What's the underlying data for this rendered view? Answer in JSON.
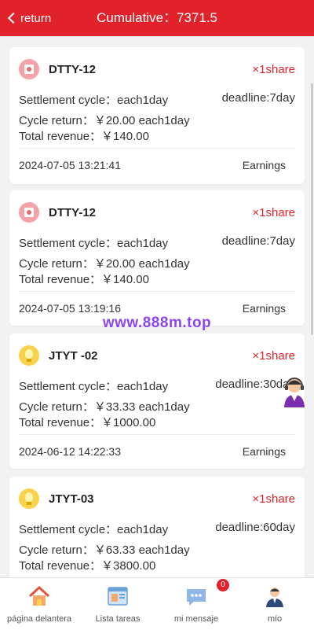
{
  "header": {
    "back_label": "return",
    "title": "Cumulative：7371.5"
  },
  "watermark": "www.888m.top",
  "cards": [
    {
      "icon": "gear-coin-icon",
      "name": "DTTY-12",
      "share": "×1share",
      "cycle": "Settlement cycle：each1day",
      "deadline": "deadline:7day",
      "cycle_return": "Cycle return：￥20.00 each1day",
      "total_revenue": "Total revenue：￥140.00",
      "datetime": "2024-07-05 13:21:41",
      "status": "Earnings"
    },
    {
      "icon": "gear-coin-icon",
      "name": "DTTY-12",
      "share": "×1share",
      "cycle": "Settlement cycle：each1day",
      "deadline": "deadline:7day",
      "cycle_return": "Cycle return：￥20.00 each1day",
      "total_revenue": "Total revenue：￥140.00",
      "datetime": "2024-07-05 13:19:16",
      "status": "Earnings"
    },
    {
      "icon": "lightbulb-icon",
      "name": "JTYT -02",
      "share": "×1share",
      "cycle": "Settlement cycle：each1day",
      "deadline": "deadline:30day",
      "cycle_return": "Cycle return：￥33.33 each1day",
      "total_revenue": "Total revenue：￥1000.00",
      "datetime": "2024-06-12 14:22:33",
      "status": "Earnings"
    },
    {
      "icon": "lightbulb-icon",
      "name": "JTYT-03",
      "share": "×1share",
      "cycle": "Settlement cycle：each1day",
      "deadline": "deadline:60day",
      "cycle_return": "Cycle return：￥63.33 each1day",
      "total_revenue": "Total revenue：￥3800.00",
      "datetime": "",
      "status": ""
    }
  ],
  "tabbar": {
    "items": [
      {
        "label": "página delantera",
        "icon": "home-icon"
      },
      {
        "label": "Lista tareas",
        "icon": "task-list-icon"
      },
      {
        "label": "mi mensaje",
        "icon": "chat-icon",
        "badge": "0"
      },
      {
        "label": "mío",
        "icon": "user-icon"
      }
    ]
  },
  "colors": {
    "brand_red": "#e2222a",
    "watermark_purple": "#8b45f0"
  }
}
